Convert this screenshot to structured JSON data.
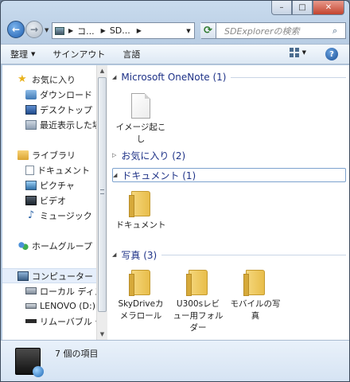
{
  "window": {
    "minimize_label": "–",
    "maximize_label": "□",
    "close_label": "✕"
  },
  "address": {
    "crumbs": [
      "コ...",
      "SD..."
    ],
    "refresh_glyph": "⟳"
  },
  "search": {
    "placeholder": "SDExplorerの検索"
  },
  "toolbar": {
    "organize": "整理",
    "signout": "サインアウト",
    "language": "言語",
    "help": "?"
  },
  "nav": {
    "favorites": {
      "label": "お気に入り",
      "items": [
        "ダウンロード",
        "デスクトップ",
        "最近表示した場所"
      ]
    },
    "libraries": {
      "label": "ライブラリ",
      "items": [
        "ドキュメント",
        "ピクチャ",
        "ビデオ",
        "ミュージック"
      ]
    },
    "homegroup": {
      "label": "ホームグループ"
    },
    "computer": {
      "label": "コンピューター",
      "items": [
        "ローカル ディスク",
        "LENOVO (D:)",
        "リムーバブル デ"
      ]
    }
  },
  "groups": {
    "onenote": {
      "header": "Microsoft OneNote (1)",
      "items": [
        {
          "label": "イメージ起こし",
          "icon": "file-icon"
        }
      ]
    },
    "favorites": {
      "header": "お気に入り (2)"
    },
    "documents": {
      "header": "ドキュメント (1)",
      "items": [
        {
          "label": "ドキュメント",
          "icon": "folder-icon"
        }
      ]
    },
    "photos": {
      "header": "写真 (3)",
      "items": [
        {
          "label": "SkyDriveカメラロール",
          "icon": "folder-icon"
        },
        {
          "label": "U300sレビュー用フォルダー",
          "icon": "folder-icon"
        },
        {
          "label": "モバイルの写真",
          "icon": "folder-icon"
        }
      ]
    }
  },
  "status": {
    "count_text": "7 個の項目"
  }
}
